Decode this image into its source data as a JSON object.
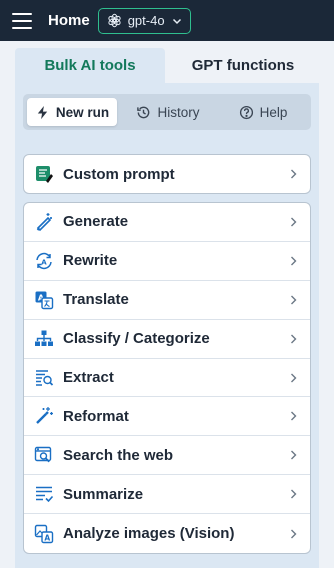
{
  "header": {
    "title": "Home",
    "model": "gpt-4o",
    "icons": {
      "menu": "hamburger-icon",
      "model": "openai-icon",
      "dropdown": "chevron-down-icon"
    }
  },
  "tabs": [
    {
      "label": "Bulk AI tools",
      "active": true
    },
    {
      "label": "GPT functions",
      "active": false
    }
  ],
  "subnav": [
    {
      "label": "New run",
      "icon": "lightning-icon",
      "active": true
    },
    {
      "label": "History",
      "icon": "history-icon",
      "active": false
    },
    {
      "label": "Help",
      "icon": "help-icon",
      "active": false
    }
  ],
  "custom_prompt": {
    "label": "Custom prompt",
    "icon": "custom-prompt-icon"
  },
  "tools": [
    {
      "label": "Generate",
      "icon": "magic-pen-icon"
    },
    {
      "label": "Rewrite",
      "icon": "rewrite-icon"
    },
    {
      "label": "Translate",
      "icon": "translate-icon"
    },
    {
      "label": "Classify / Categorize",
      "icon": "hierarchy-icon"
    },
    {
      "label": "Extract",
      "icon": "extract-icon"
    },
    {
      "label": "Reformat",
      "icon": "magic-wand-icon"
    },
    {
      "label": "Search the web",
      "icon": "web-search-icon"
    },
    {
      "label": "Summarize",
      "icon": "summarize-icon"
    },
    {
      "label": "Analyze images (Vision)",
      "icon": "image-analyze-icon"
    }
  ],
  "colors": {
    "topbar": "#1b2838",
    "accent_green": "#2fbf8f",
    "active_tab_text": "#13795b",
    "icon_blue": "#1a6fc4",
    "panel_bg": "#dbe7f3"
  }
}
